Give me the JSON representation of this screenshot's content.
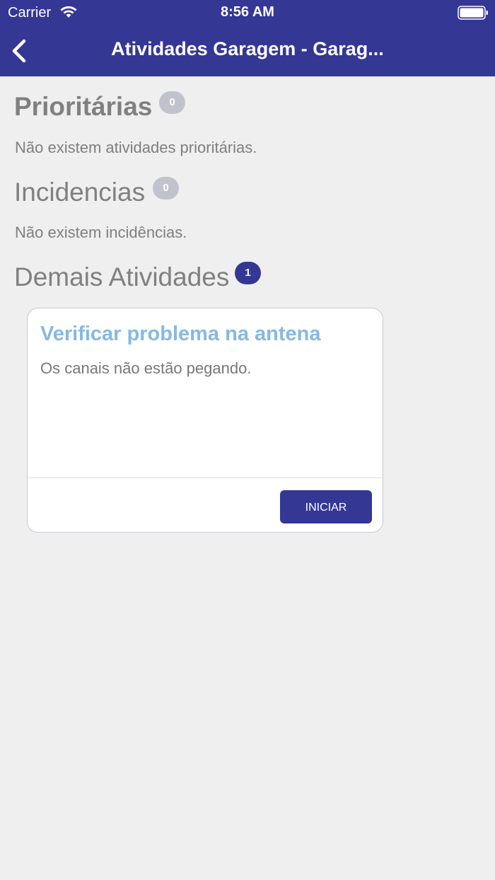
{
  "status_bar": {
    "carrier": "Carrier",
    "time": "8:56 AM",
    "wifi_icon": "wifi-icon",
    "battery_icon": "battery-icon"
  },
  "nav": {
    "back_icon": "chevron-left-icon",
    "title": "Atividades Garagem - Garag..."
  },
  "sections": {
    "priority": {
      "title": "Prioritárias",
      "count": "0",
      "empty_text": "Não existem atividades prioritárias."
    },
    "incidents": {
      "title": "Incidencias",
      "count": "0",
      "empty_text": "Não existem incidências."
    },
    "other": {
      "title": "Demais Atividades",
      "count": "1"
    }
  },
  "activities": [
    {
      "title": "Verificar problema na antena",
      "description": "Os canais não estão pegando.",
      "action_label": "INICIAR"
    }
  ],
  "colors": {
    "primary": "#353795",
    "background": "#efefef",
    "badge_inactive": "#c0c3cc",
    "card_title": "#86b9e3"
  }
}
